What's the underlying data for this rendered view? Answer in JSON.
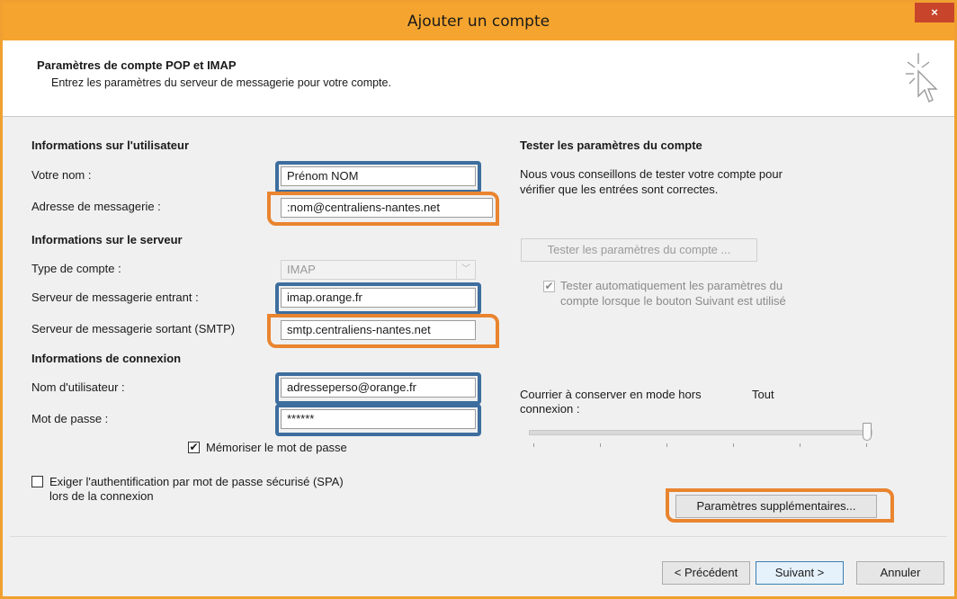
{
  "window": {
    "title": "Ajouter un compte",
    "close": "×"
  },
  "header": {
    "title": "Paramètres de compte POP et IMAP",
    "subtitle": "Entrez les paramètres du serveur de messagerie pour votre compte."
  },
  "user_info": {
    "section": "Informations sur l'utilisateur",
    "name_label": "Votre nom :",
    "name_value": "Prénom NOM",
    "email_label": "Adresse de messagerie :",
    "email_value": ":nom@centraliens-nantes.net"
  },
  "server_info": {
    "section": "Informations sur le serveur",
    "type_label": "Type de compte :",
    "type_value": "IMAP",
    "incoming_label": "Serveur de messagerie entrant :",
    "incoming_value": "imap.orange.fr",
    "outgoing_label": "Serveur de messagerie sortant (SMTP)",
    "outgoing_value": "smtp.centraliens-nantes.net"
  },
  "login_info": {
    "section": "Informations de connexion",
    "user_label": "Nom d'utilisateur :",
    "user_value": "adresseperso@orange.fr",
    "password_label": "Mot de passe :",
    "password_value": "******",
    "remember_label": "Mémoriser le mot de passe",
    "remember_checked": true,
    "spa_label_1": "Exiger l'authentification par mot de passe sécurisé (SPA)",
    "spa_label_2": "lors de la connexion",
    "spa_checked": false
  },
  "test": {
    "section": "Tester les paramètres du compte",
    "description_1": "Nous vous conseillons de tester votre compte pour",
    "description_2": "vérifier que les entrées sont correctes.",
    "button": "Tester les paramètres du compte ...",
    "auto_label_1": "Tester automatiquement les paramètres du",
    "auto_label_2": "compte lorsque le bouton Suivant est utilisé",
    "auto_checked": true
  },
  "offline": {
    "label_1": "Courrier à conserver en mode hors",
    "label_2": "connexion :",
    "value": "Tout",
    "slider_level": 1.0
  },
  "more_settings": "Paramètres supplémentaires...",
  "footer": {
    "previous": "< Précédent",
    "next": "Suivant >",
    "cancel": "Annuler"
  },
  "colors": {
    "title_bar": "#f5a52f",
    "highlight_blue": "#3d6e9e",
    "highlight_orange": "#e9842f",
    "close": "#c8452c"
  }
}
